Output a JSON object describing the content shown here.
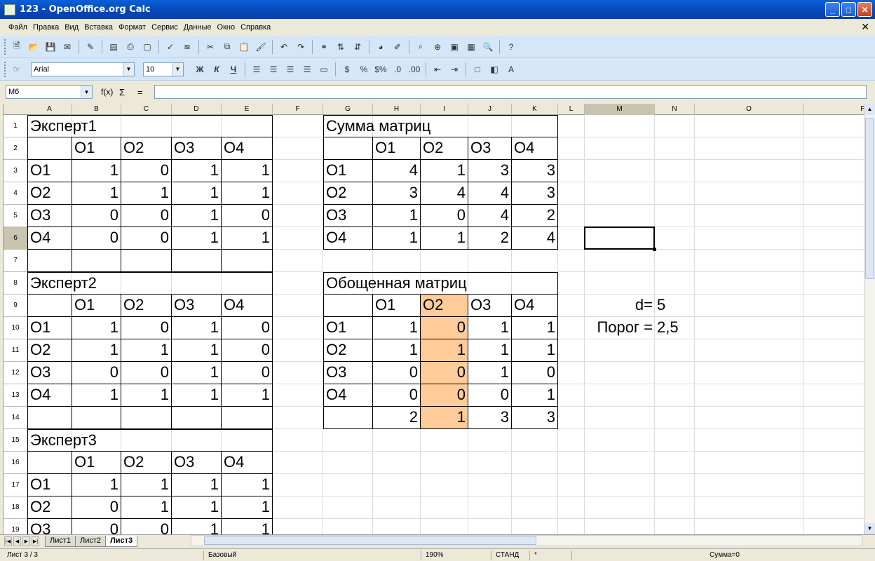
{
  "window": {
    "title": "123 - OpenOffice.org Calc",
    "minimize": "_",
    "maximize": "□",
    "close": "✕"
  },
  "menu": [
    "Файл",
    "Правка",
    "Вид",
    "Вставка",
    "Формат",
    "Сервис",
    "Данные",
    "Окно",
    "Справка"
  ],
  "doc_close": "✕",
  "toolbar_icons": [
    "new-icon",
    "open-icon",
    "save-icon",
    "email-icon",
    "edit-mode-icon",
    "export-pdf-icon",
    "print-icon",
    "page-preview-icon",
    "spellcheck-icon",
    "autospellcheck-icon",
    "cut-icon",
    "copy-icon",
    "paste-icon",
    "format-paintbrush-icon",
    "undo-icon",
    "redo-icon",
    "hyperlink-icon",
    "sort-ascending-icon",
    "sort-descending-icon",
    "chart-icon",
    "draw-functions-icon",
    "find-replace-icon",
    "navigator-icon",
    "gallery-icon",
    "datasources-icon",
    "zoom-icon",
    "help-icon"
  ],
  "format_toolbar": {
    "font_name": "Arial",
    "font_size": "10",
    "bold": "Ж",
    "italic": "К",
    "underline": "Ч"
  },
  "formula_bar": {
    "name_box": "M6",
    "fx": "f(x)",
    "sigma": "Σ",
    "equals": "=",
    "content": ""
  },
  "columns": [
    "A",
    "B",
    "C",
    "D",
    "E",
    "F",
    "G",
    "H",
    "I",
    "J",
    "K",
    "L",
    "M",
    "N",
    "O",
    "P"
  ],
  "rows": [
    "1",
    "2",
    "3",
    "4",
    "5",
    "6",
    "7",
    "8",
    "9",
    "10",
    "11",
    "12",
    "13",
    "14",
    "15",
    "16",
    "17",
    "18",
    "19"
  ],
  "selected_cell": "M6",
  "sheet": {
    "expert1": {
      "title": "Эксперт1",
      "headers": [
        "O1",
        "O2",
        "O3",
        "O4"
      ],
      "rows": [
        {
          "label": "O1",
          "values": [
            "1",
            "0",
            "1",
            "1"
          ]
        },
        {
          "label": "O2",
          "values": [
            "1",
            "1",
            "1",
            "1"
          ]
        },
        {
          "label": "O3",
          "values": [
            "0",
            "0",
            "1",
            "0"
          ]
        },
        {
          "label": "O4",
          "values": [
            "0",
            "0",
            "1",
            "1"
          ]
        }
      ]
    },
    "expert2": {
      "title": "Эксперт2",
      "headers": [
        "O1",
        "O2",
        "O3",
        "O4"
      ],
      "rows": [
        {
          "label": "O1",
          "values": [
            "1",
            "0",
            "1",
            "0"
          ]
        },
        {
          "label": "O2",
          "values": [
            "1",
            "1",
            "1",
            "0"
          ]
        },
        {
          "label": "O3",
          "values": [
            "0",
            "0",
            "1",
            "0"
          ]
        },
        {
          "label": "O4",
          "values": [
            "1",
            "1",
            "1",
            "1"
          ]
        }
      ]
    },
    "expert3": {
      "title": "Эксперт3",
      "headers": [
        "O1",
        "O2",
        "O3",
        "O4"
      ],
      "rows": [
        {
          "label": "O1",
          "values": [
            "1",
            "1",
            "1",
            "1"
          ]
        },
        {
          "label": "O2",
          "values": [
            "0",
            "1",
            "1",
            "1"
          ]
        },
        {
          "label": "O3",
          "values": [
            "0",
            "0",
            "1",
            "1"
          ]
        }
      ]
    },
    "sum_matrix": {
      "title": "Сумма матриц",
      "headers": [
        "O1",
        "O2",
        "O3",
        "O4"
      ],
      "rows": [
        {
          "label": "O1",
          "values": [
            "4",
            "1",
            "3",
            "3"
          ]
        },
        {
          "label": "O2",
          "values": [
            "3",
            "4",
            "4",
            "3"
          ]
        },
        {
          "label": "O3",
          "values": [
            "1",
            "0",
            "4",
            "2"
          ]
        },
        {
          "label": "O4",
          "values": [
            "1",
            "1",
            "2",
            "4"
          ]
        }
      ]
    },
    "generalized_matrix": {
      "title": "Обощенная матриц",
      "headers": [
        "O1",
        "O2",
        "O3",
        "O4"
      ],
      "rows": [
        {
          "label": "O1",
          "values": [
            "1",
            "0",
            "1",
            "1"
          ]
        },
        {
          "label": "O2",
          "values": [
            "1",
            "1",
            "1",
            "1"
          ]
        },
        {
          "label": "O3",
          "values": [
            "0",
            "0",
            "1",
            "0"
          ]
        },
        {
          "label": "O4",
          "values": [
            "0",
            "0",
            "0",
            "1"
          ]
        }
      ],
      "totals": [
        "2",
        "1",
        "3",
        "3"
      ],
      "highlight_color": "#ffcc99"
    },
    "params": {
      "d_label": "d=",
      "d_value": "5",
      "threshold_label": "Порог =",
      "threshold_value": "2,5"
    }
  },
  "sheet_tabs": [
    "Лист1",
    "Лист2",
    "Лист3"
  ],
  "active_tab": "Лист3",
  "status": {
    "sheet": "Лист 3 / 3",
    "style": "Базовый",
    "zoom": "190%",
    "mode": "СТАНД",
    "modified": "*",
    "sum": "Сумма=0"
  }
}
